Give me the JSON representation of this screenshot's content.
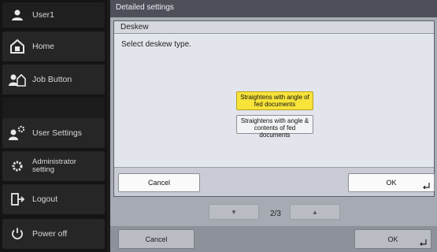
{
  "sidebar": {
    "user": "User1",
    "home": "Home",
    "job_button": "Job Button",
    "user_settings": "User Settings",
    "admin_line1": "Administrator",
    "admin_line2": "setting",
    "logout": "Logout",
    "power_off": "Power off"
  },
  "header": {
    "title": "Detailed settings"
  },
  "dialog": {
    "title": "Deskew",
    "prompt": "Select deskew type.",
    "options": [
      {
        "label_line1": "Straightens with angle of",
        "label_line2": "fed documents",
        "selected": true
      },
      {
        "label_line1": "Straightens with angle &",
        "label_line2": "contents of fed documents",
        "selected": false
      }
    ],
    "cancel_label": "Cancel",
    "ok_label": "OK"
  },
  "pager": {
    "page": "2/3",
    "down_icon": "triangle-down",
    "up_icon": "triangle-up"
  },
  "footer": {
    "cancel_label": "Cancel",
    "ok_label": "OK"
  },
  "colors": {
    "selected_option": "#f7e33a",
    "sidebar_bg": "#141414",
    "main_bg": "#a6aab2"
  }
}
